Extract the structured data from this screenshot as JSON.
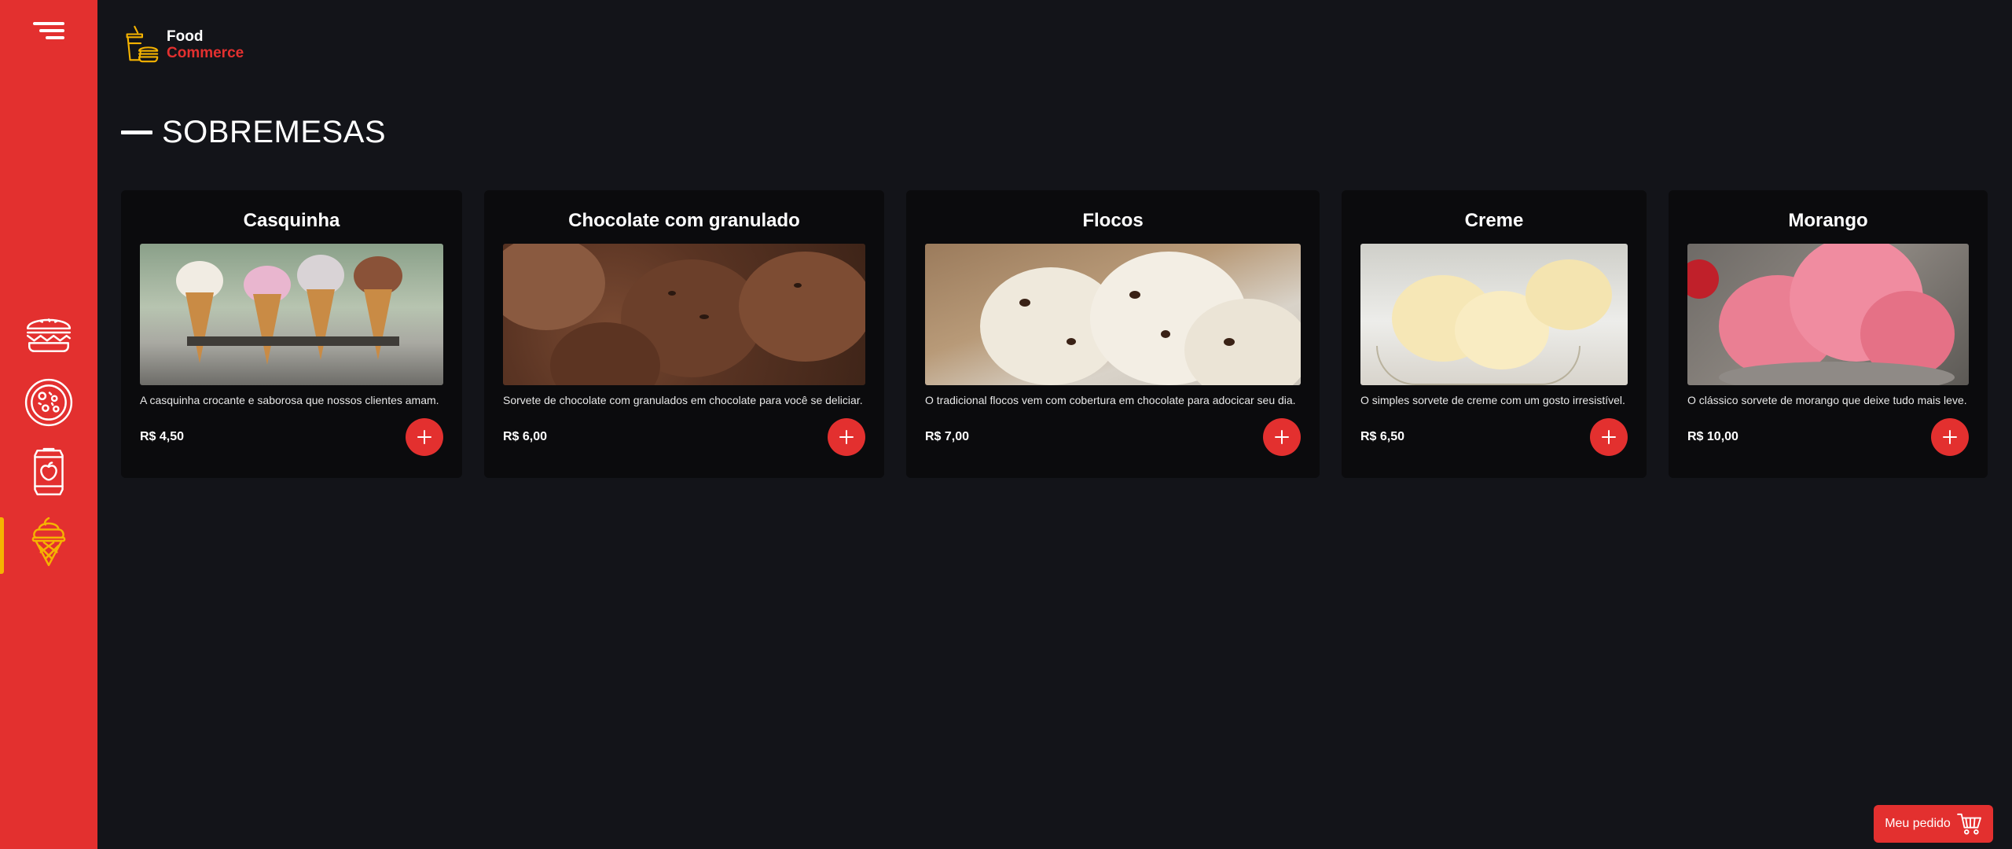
{
  "app": {
    "logo_line1": "Food",
    "logo_line2": "Commerce"
  },
  "sidebar": {
    "items": [
      {
        "name": "burger",
        "icon": "burger-icon",
        "active": false
      },
      {
        "name": "pizza",
        "icon": "pizza-icon",
        "active": false
      },
      {
        "name": "drinks",
        "icon": "soda-can-icon",
        "active": false
      },
      {
        "name": "desserts",
        "icon": "ice-cream-icon",
        "active": true
      }
    ],
    "accent_color": "#f5b301"
  },
  "page": {
    "title": "SOBREMESAS"
  },
  "products": [
    {
      "title": "Casquinha",
      "description": "A casquinha crocante e saborosa que nossos clientes amam.",
      "price": "R$ 4,50"
    },
    {
      "title": "Chocolate com granulado",
      "description": "Sorvete de chocolate com granulados em chocolate para você se deliciar.",
      "price": "R$ 6,00"
    },
    {
      "title": "Flocos",
      "description": "O tradicional flocos vem com cobertura em chocolate para adocicar seu dia.",
      "price": "R$ 7,00"
    },
    {
      "title": "Creme",
      "description": "O simples sorvete de creme com um gosto irresistível.",
      "price": "R$ 6,50"
    },
    {
      "title": "Morango",
      "description": "O clássico sorvete de morango que deixe tudo mais leve.",
      "price": "R$ 10,00"
    }
  ],
  "order": {
    "label": "Meu pedido"
  },
  "colors": {
    "brand_red": "#e3302f",
    "background": "#131419",
    "card": "#0b0b0d"
  }
}
